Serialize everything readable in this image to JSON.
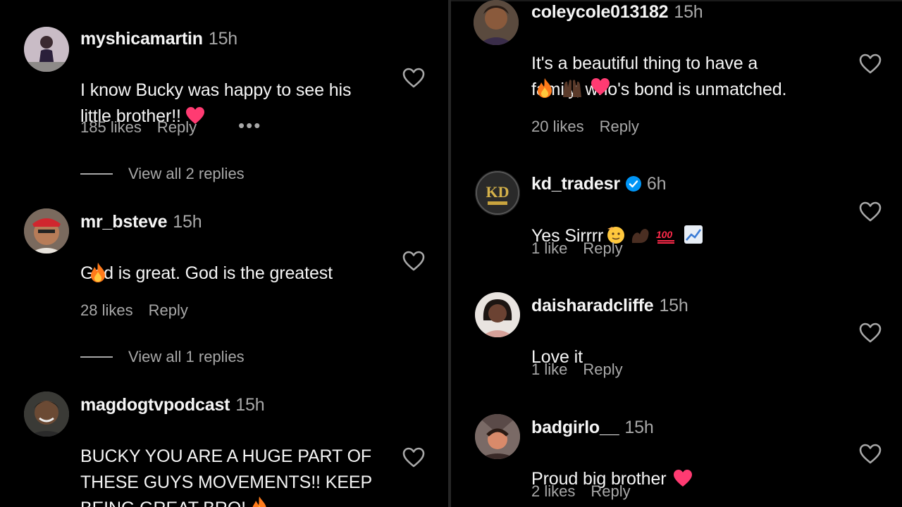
{
  "colors": {
    "background": "#000000",
    "primary_text": "#f5f5f5",
    "secondary_text": "#a8a8a8",
    "heart_emoji": "#ff3b72",
    "verified_badge": "#0095f6"
  },
  "left_column": {
    "comments": [
      {
        "username": "myshicamartin",
        "time": "15h",
        "text": "I know Bucky was happy to see his\nlittle brother!!",
        "emojis": [
          "red-heart"
        ],
        "likes": "185 likes",
        "reply": "Reply",
        "more": "•••",
        "view_replies": "View all 2 replies"
      },
      {
        "username": "mr_bsteve",
        "time": "15h",
        "text": "God is great. God is the greatest",
        "emojis": [
          "fire"
        ],
        "likes": "28 likes",
        "reply": "Reply",
        "view_replies": "View all 1 replies"
      },
      {
        "username": "magdogtvpodcast",
        "time": "15h",
        "text": "BUCKY YOU ARE A HUGE PART OF\nTHESE GUYS MOVEMENTS!! KEEP\nBEING GREAT BRO!",
        "emojis": [
          "fire"
        ]
      }
    ]
  },
  "right_column": {
    "comments": [
      {
        "username": "coleycole013182",
        "time": "15h",
        "text": "It's a beautiful thing to have a\nfamily, who's bond is unmatched.",
        "emojis": [
          "fire",
          "raised-hands",
          "red-heart"
        ],
        "likes": "20 likes",
        "reply": "Reply"
      },
      {
        "username": "kd_tradesr",
        "time": "6h",
        "verified": true,
        "text": "Yes Sirrrr",
        "emojis": [
          "saluting-face",
          "flexed-biceps",
          "hundred-points",
          "chart-increasing"
        ],
        "likes": "1 like",
        "reply": "Reply"
      },
      {
        "username": "daisharadcliffe",
        "time": "15h",
        "text": "Love it",
        "emojis": [],
        "likes": "1 like",
        "reply": "Reply"
      },
      {
        "username": "badgirlo__",
        "time": "15h",
        "text": "Proud big brother",
        "emojis": [
          "red-heart"
        ],
        "likes": "2 likes",
        "reply": "Reply"
      }
    ]
  }
}
